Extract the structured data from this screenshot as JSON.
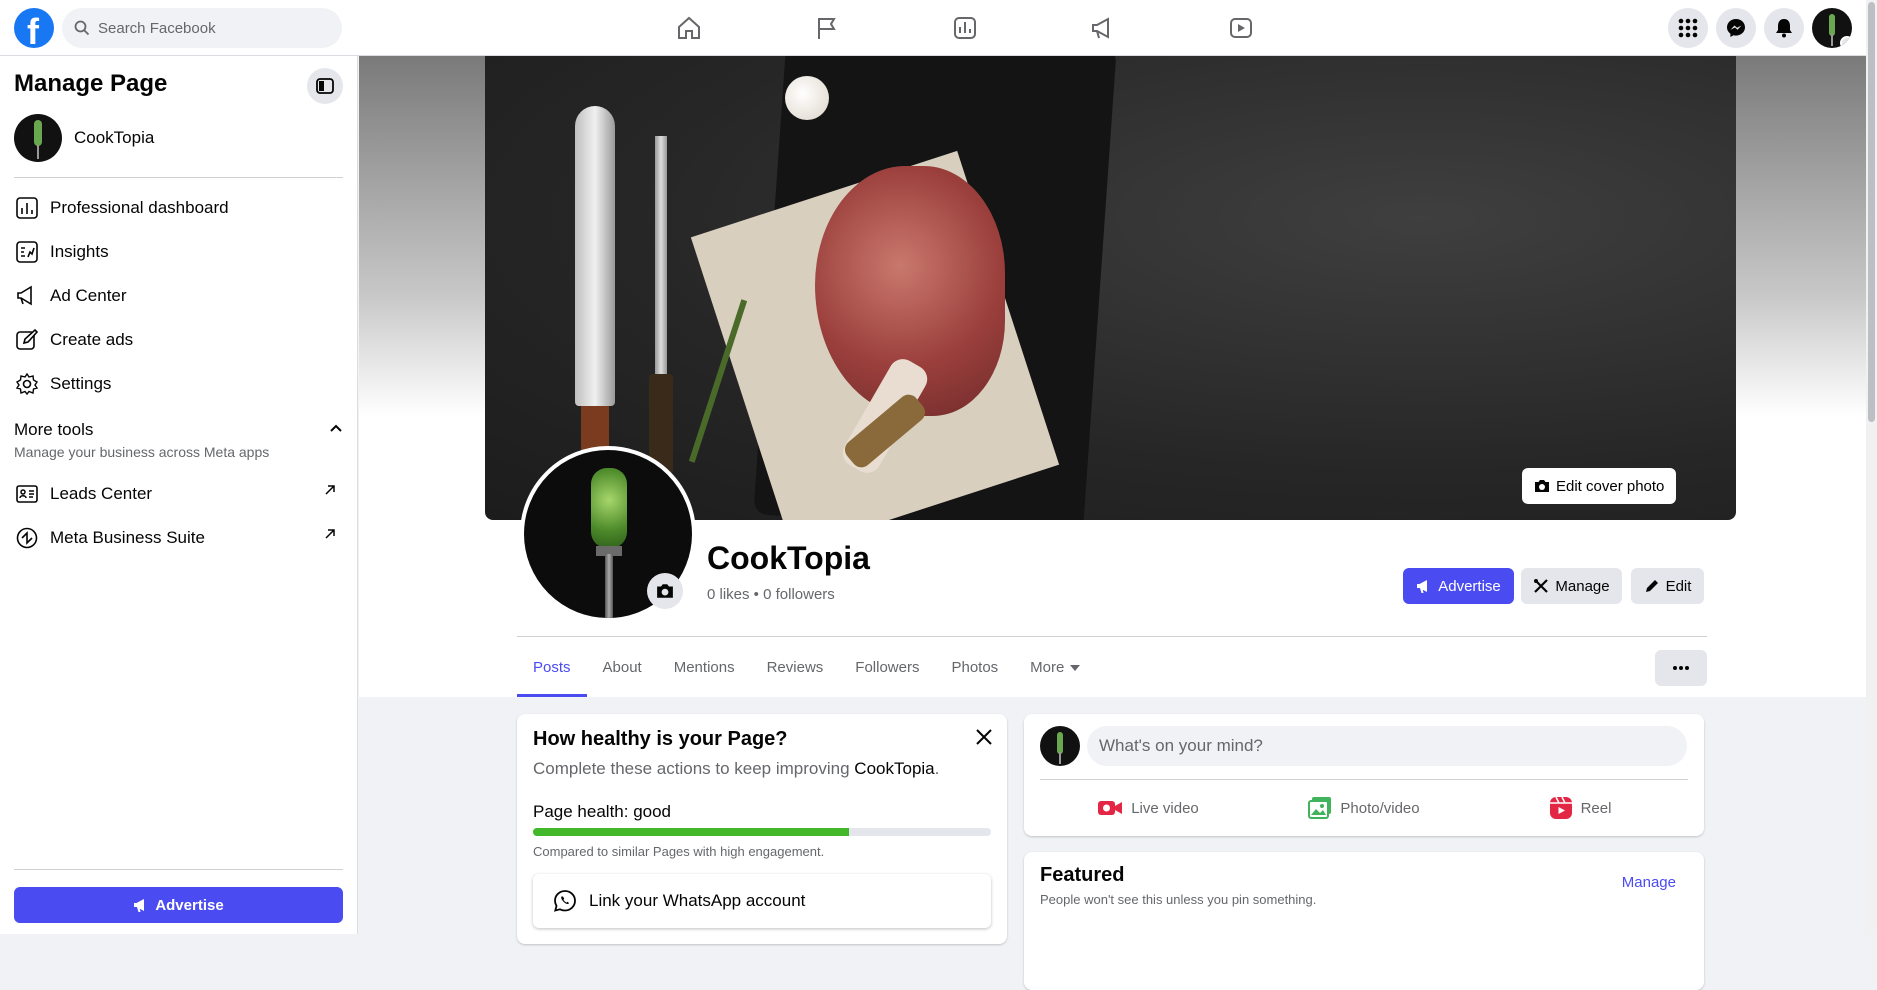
{
  "topbar": {
    "logo_letter": "f",
    "search_placeholder": "Search Facebook",
    "nav_icons": [
      "home-icon",
      "flag-icon",
      "insights-icon",
      "megaphone-icon",
      "video-icon"
    ],
    "right_icons": [
      "menu-grid-icon",
      "messenger-icon",
      "notifications-icon",
      "account-avatar"
    ]
  },
  "sidebar": {
    "title": "Manage Page",
    "page_name": "CookTopia",
    "items": [
      {
        "label": "Professional dashboard",
        "icon": "dashboard-icon"
      },
      {
        "label": "Insights",
        "icon": "insights-icon"
      },
      {
        "label": "Ad Center",
        "icon": "megaphone-icon"
      },
      {
        "label": "Create ads",
        "icon": "pencil-icon"
      },
      {
        "label": "Settings",
        "icon": "gear-icon"
      }
    ],
    "more_tools": {
      "title": "More tools",
      "subtitle": "Manage your business across Meta apps"
    },
    "tools": [
      {
        "label": "Leads Center",
        "icon": "leads-icon"
      },
      {
        "label": "Meta Business Suite",
        "icon": "meta-icon"
      }
    ],
    "advertise_label": "Advertise"
  },
  "profile": {
    "name": "CookTopia",
    "stats": "0 likes • 0 followers",
    "edit_cover_label": "Edit cover photo",
    "advertise_label": "Advertise",
    "manage_label": "Manage",
    "edit_label": "Edit"
  },
  "tabs": [
    {
      "label": "Posts",
      "active": true
    },
    {
      "label": "About"
    },
    {
      "label": "Mentions"
    },
    {
      "label": "Reviews"
    },
    {
      "label": "Followers"
    },
    {
      "label": "Photos"
    },
    {
      "label": "More"
    }
  ],
  "health_card": {
    "title": "How healthy is your Page?",
    "subtitle_prefix": "Complete these actions to keep improving ",
    "subtitle_page": "CookTopia",
    "subtitle_suffix": ".",
    "health_label": "Page health: good",
    "health_progress": 0.69,
    "comparison": "Compared to similar Pages with high engagement.",
    "whatsapp_label": "Link your WhatsApp account"
  },
  "composer": {
    "placeholder": "What's on your mind?",
    "actions": [
      {
        "label": "Live video",
        "icon": "live-video-icon"
      },
      {
        "label": "Photo/video",
        "icon": "photo-icon"
      },
      {
        "label": "Reel",
        "icon": "reel-icon"
      }
    ]
  },
  "featured": {
    "title": "Featured",
    "subtitle": "People won't see this unless you pin something.",
    "manage_label": "Manage"
  },
  "colors": {
    "brand_blue": "#1877f2",
    "accent": "#4b4bf2",
    "health_green": "#42b72a"
  }
}
